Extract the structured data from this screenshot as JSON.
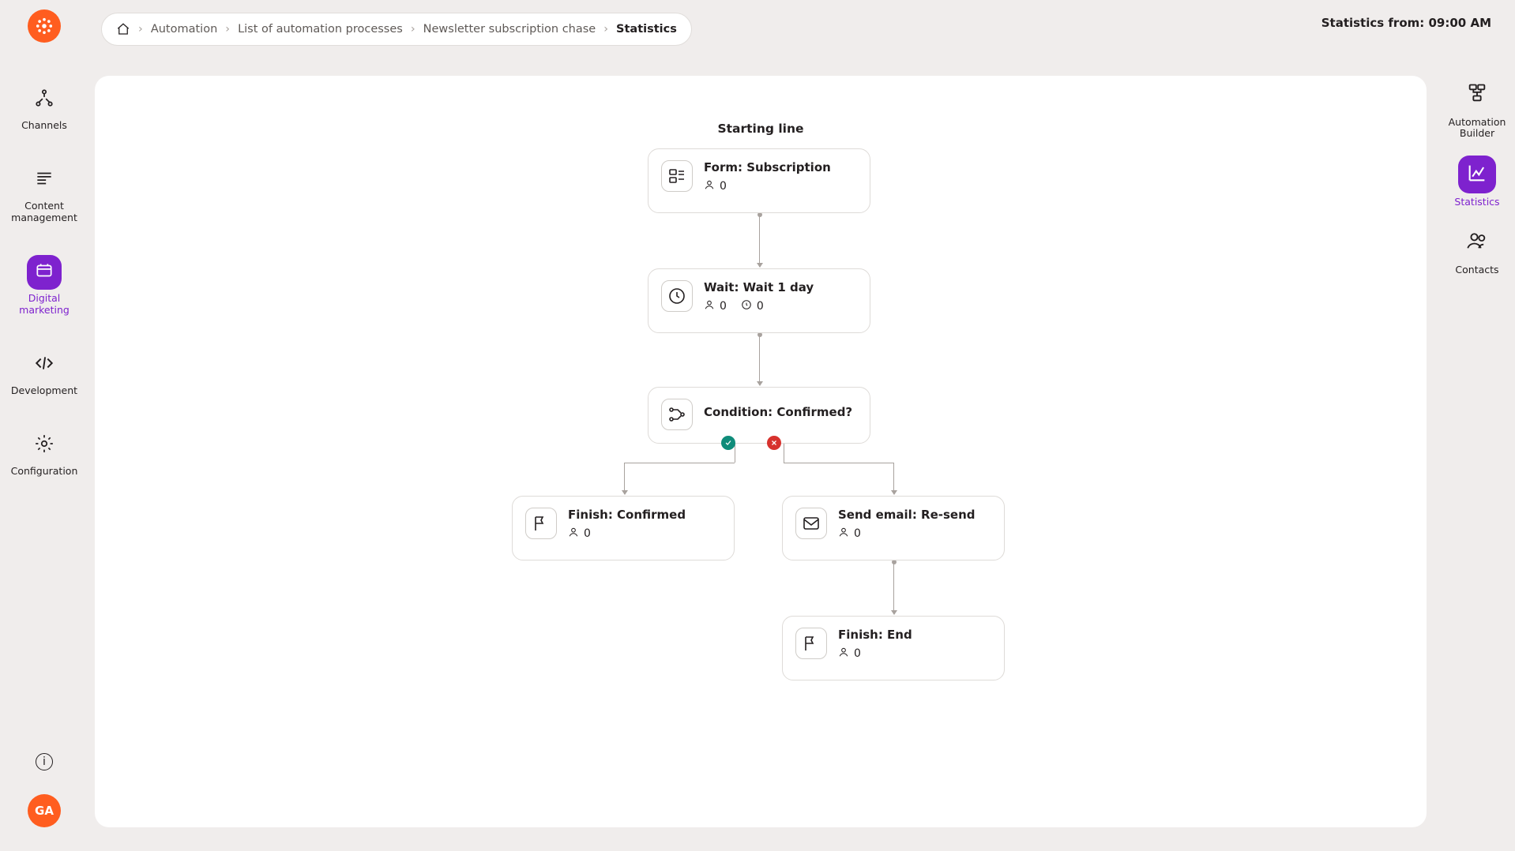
{
  "breadcrumb": {
    "items": [
      {
        "label": "Automation"
      },
      {
        "label": "List of automation processes"
      },
      {
        "label": "Newsletter subscription chase"
      },
      {
        "label": "Statistics"
      }
    ]
  },
  "stats_from": "Statistics from: 09:00 AM",
  "left_nav": {
    "channels": "Channels",
    "content": "Content management",
    "digital": "Digital marketing",
    "dev": "Development",
    "config": "Configuration"
  },
  "avatar": "GA",
  "right_nav": {
    "builder": "Automation Builder",
    "statistics": "Statistics",
    "contacts": "Contacts"
  },
  "flow": {
    "starting_line": "Starting line",
    "form": {
      "title": "Form: Subscription",
      "people": "0"
    },
    "wait": {
      "title": "Wait: Wait 1 day",
      "people": "0",
      "waiting": "0"
    },
    "condition": {
      "title": "Condition: Confirmed?"
    },
    "finish_conf": {
      "title": "Finish: Confirmed",
      "people": "0"
    },
    "send": {
      "title": "Send email: Re-send",
      "people": "0"
    },
    "finish_end": {
      "title": "Finish: End",
      "people": "0"
    }
  }
}
